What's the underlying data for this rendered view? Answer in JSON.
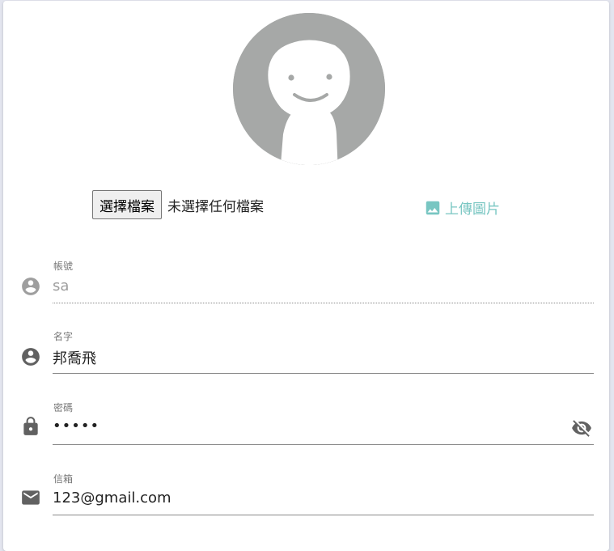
{
  "upload": {
    "choose_button": "選擇檔案",
    "no_file_text": "未選擇任何檔案",
    "upload_label": "上傳圖片"
  },
  "fields": {
    "account": {
      "label": "帳號",
      "value": "sa",
      "icon": "account-circle-icon"
    },
    "name": {
      "label": "名字",
      "value": "邦喬飛",
      "icon": "account-circle-icon"
    },
    "password": {
      "label": "密碼",
      "value": "•••••",
      "icon": "lock-icon"
    },
    "email": {
      "label": "信箱",
      "value": "123@gmail.com",
      "icon": "email-icon"
    }
  },
  "colors": {
    "accent": "#78c6c2",
    "icon": "#757575",
    "avatar_bg": "#a6a8a7"
  }
}
